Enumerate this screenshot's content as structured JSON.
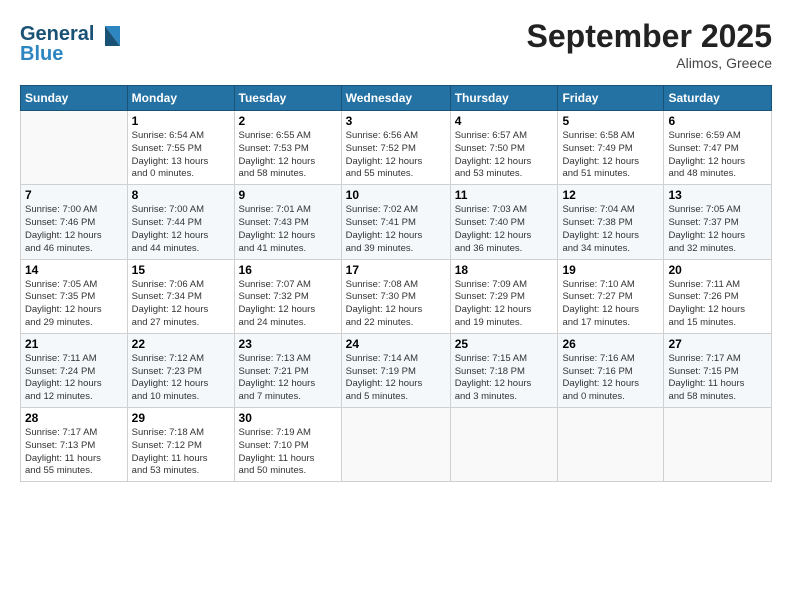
{
  "header": {
    "logo_line1": "General",
    "logo_line2": "Blue",
    "month": "September 2025",
    "location": "Alimos, Greece"
  },
  "weekdays": [
    "Sunday",
    "Monday",
    "Tuesday",
    "Wednesday",
    "Thursday",
    "Friday",
    "Saturday"
  ],
  "weeks": [
    [
      {
        "day": "",
        "info": ""
      },
      {
        "day": "1",
        "info": "Sunrise: 6:54 AM\nSunset: 7:55 PM\nDaylight: 13 hours\nand 0 minutes."
      },
      {
        "day": "2",
        "info": "Sunrise: 6:55 AM\nSunset: 7:53 PM\nDaylight: 12 hours\nand 58 minutes."
      },
      {
        "day": "3",
        "info": "Sunrise: 6:56 AM\nSunset: 7:52 PM\nDaylight: 12 hours\nand 55 minutes."
      },
      {
        "day": "4",
        "info": "Sunrise: 6:57 AM\nSunset: 7:50 PM\nDaylight: 12 hours\nand 53 minutes."
      },
      {
        "day": "5",
        "info": "Sunrise: 6:58 AM\nSunset: 7:49 PM\nDaylight: 12 hours\nand 51 minutes."
      },
      {
        "day": "6",
        "info": "Sunrise: 6:59 AM\nSunset: 7:47 PM\nDaylight: 12 hours\nand 48 minutes."
      }
    ],
    [
      {
        "day": "7",
        "info": "Sunrise: 7:00 AM\nSunset: 7:46 PM\nDaylight: 12 hours\nand 46 minutes."
      },
      {
        "day": "8",
        "info": "Sunrise: 7:00 AM\nSunset: 7:44 PM\nDaylight: 12 hours\nand 44 minutes."
      },
      {
        "day": "9",
        "info": "Sunrise: 7:01 AM\nSunset: 7:43 PM\nDaylight: 12 hours\nand 41 minutes."
      },
      {
        "day": "10",
        "info": "Sunrise: 7:02 AM\nSunset: 7:41 PM\nDaylight: 12 hours\nand 39 minutes."
      },
      {
        "day": "11",
        "info": "Sunrise: 7:03 AM\nSunset: 7:40 PM\nDaylight: 12 hours\nand 36 minutes."
      },
      {
        "day": "12",
        "info": "Sunrise: 7:04 AM\nSunset: 7:38 PM\nDaylight: 12 hours\nand 34 minutes."
      },
      {
        "day": "13",
        "info": "Sunrise: 7:05 AM\nSunset: 7:37 PM\nDaylight: 12 hours\nand 32 minutes."
      }
    ],
    [
      {
        "day": "14",
        "info": "Sunrise: 7:05 AM\nSunset: 7:35 PM\nDaylight: 12 hours\nand 29 minutes."
      },
      {
        "day": "15",
        "info": "Sunrise: 7:06 AM\nSunset: 7:34 PM\nDaylight: 12 hours\nand 27 minutes."
      },
      {
        "day": "16",
        "info": "Sunrise: 7:07 AM\nSunset: 7:32 PM\nDaylight: 12 hours\nand 24 minutes."
      },
      {
        "day": "17",
        "info": "Sunrise: 7:08 AM\nSunset: 7:30 PM\nDaylight: 12 hours\nand 22 minutes."
      },
      {
        "day": "18",
        "info": "Sunrise: 7:09 AM\nSunset: 7:29 PM\nDaylight: 12 hours\nand 19 minutes."
      },
      {
        "day": "19",
        "info": "Sunrise: 7:10 AM\nSunset: 7:27 PM\nDaylight: 12 hours\nand 17 minutes."
      },
      {
        "day": "20",
        "info": "Sunrise: 7:11 AM\nSunset: 7:26 PM\nDaylight: 12 hours\nand 15 minutes."
      }
    ],
    [
      {
        "day": "21",
        "info": "Sunrise: 7:11 AM\nSunset: 7:24 PM\nDaylight: 12 hours\nand 12 minutes."
      },
      {
        "day": "22",
        "info": "Sunrise: 7:12 AM\nSunset: 7:23 PM\nDaylight: 12 hours\nand 10 minutes."
      },
      {
        "day": "23",
        "info": "Sunrise: 7:13 AM\nSunset: 7:21 PM\nDaylight: 12 hours\nand 7 minutes."
      },
      {
        "day": "24",
        "info": "Sunrise: 7:14 AM\nSunset: 7:19 PM\nDaylight: 12 hours\nand 5 minutes."
      },
      {
        "day": "25",
        "info": "Sunrise: 7:15 AM\nSunset: 7:18 PM\nDaylight: 12 hours\nand 3 minutes."
      },
      {
        "day": "26",
        "info": "Sunrise: 7:16 AM\nSunset: 7:16 PM\nDaylight: 12 hours\nand 0 minutes."
      },
      {
        "day": "27",
        "info": "Sunrise: 7:17 AM\nSunset: 7:15 PM\nDaylight: 11 hours\nand 58 minutes."
      }
    ],
    [
      {
        "day": "28",
        "info": "Sunrise: 7:17 AM\nSunset: 7:13 PM\nDaylight: 11 hours\nand 55 minutes."
      },
      {
        "day": "29",
        "info": "Sunrise: 7:18 AM\nSunset: 7:12 PM\nDaylight: 11 hours\nand 53 minutes."
      },
      {
        "day": "30",
        "info": "Sunrise: 7:19 AM\nSunset: 7:10 PM\nDaylight: 11 hours\nand 50 minutes."
      },
      {
        "day": "",
        "info": ""
      },
      {
        "day": "",
        "info": ""
      },
      {
        "day": "",
        "info": ""
      },
      {
        "day": "",
        "info": ""
      }
    ]
  ]
}
